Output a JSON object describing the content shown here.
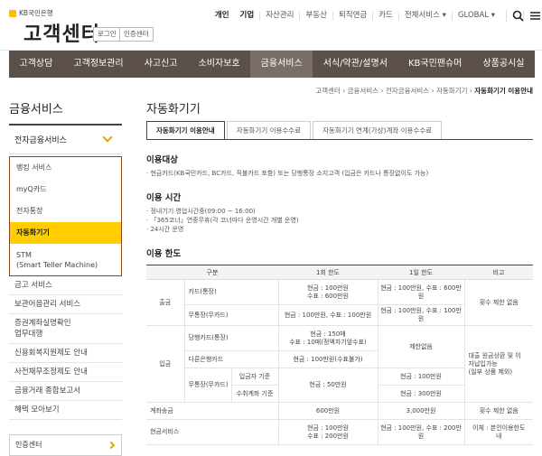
{
  "header": {
    "logo_text": "KB국민은행",
    "title": "고객센터",
    "login_label": "로그인",
    "cert_label": "인증센터",
    "util_links": [
      "개인",
      "기업",
      "자산관리",
      "부동산",
      "퇴직연금",
      "카드",
      "전체서비스 ▾",
      "GLOBAL ▾"
    ]
  },
  "gnb": [
    "고객상담",
    "고객정보관리",
    "사고신고",
    "소비자보호",
    "금융서비스",
    "서식/약관/설명서",
    "KB국민팬슈머",
    "상품공시실"
  ],
  "breadcrumb": [
    "고객센터",
    "금융서비스",
    "전자금융서비스",
    "자동화기기",
    "자동화기기 이용안내"
  ],
  "sidebar": {
    "title": "금융서비스",
    "selected": "전자금융서비스",
    "sub_items": [
      "뱅킹 서비스",
      "myQ카드",
      "전자통장",
      "자동화기기"
    ],
    "sub_last": [
      "STM",
      "(Smart Teller Machine)"
    ],
    "other_items": [
      "금고 서비스",
      "보관어음관리 서비스",
      "증권계좌실명확인",
      "업무대행",
      "신용회복지원제도 안내",
      "사전채무조정제도 안내",
      "금융거래 종합보고서",
      "혜택 모아보기"
    ],
    "cert_center": "인증센터"
  },
  "main": {
    "title": "자동화기기",
    "tabs": [
      "자동화기기 이용안내",
      "자동화기기 이용수수료",
      "자동화기기 연계(가상)계좌 이용수수료"
    ],
    "s1_title": "이용대상",
    "s1_text": "· 현금카드(KB국민카드, BC카드, 직불카드 포함) 또는 당행통장 소지고객 (입금은 카드나 통장없이도 가능)",
    "s2_title": "이용 시간",
    "s2_lines": [
      "· 정내기기 영업시간중(09:00 ~ 16:00)",
      "· 「365코너」연중무휴(각 코너마다 운영시간 개별 운영)",
      "· 24시간 운영"
    ],
    "s3_title": "이용 한도",
    "table": {
      "headers": [
        "구분",
        "1회 한도",
        "1일 한도",
        "비고"
      ],
      "c_out": "출금",
      "c_in": "입금",
      "r_card": "카드(통장)",
      "v_card1": "현금 : 100만원",
      "v_card2": "수표 : 600만원",
      "v_card_day": "현금 : 100만원, 수표 : 600만원",
      "note_out": "횟수 제한 없음",
      "r_nocard": "무통장(무카드)",
      "v_nocard": "현금 : 100만원, 수표 : 100만원",
      "v_nocard_day": "현금 : 100만원, 수표 : 100만원",
      "r_bank": "당행카드(통장)",
      "v_bank1": "현금 : 150매",
      "v_bank2": "수표 : 10매(정액자기앞수표)",
      "v_nolimit": "제한없음",
      "note_in1": "대출 원금상환 및 이",
      "note_in2": "자납입가능",
      "note_in3": "(일부 상품 제외)",
      "r_other": "다른은행카드",
      "v_other": "현금 : 100만원(수표불가)",
      "r_nocard2": "무통장(무카드)",
      "r_deposit": "입금자 기준",
      "r_receive": "수취계좌 기준",
      "v_50": "현금 : 50만원",
      "v_100": "현금 : 100만원",
      "v_300": "현금 : 300만원",
      "r_transfer": "계좌송금",
      "v_600": "600만원",
      "v_3000": "3,000만원",
      "note_transfer": "횟수 제한 없음",
      "r_cash": "현금서비스",
      "v_cash1": "현금 : 100만원",
      "v_cash2": "수표 : 200만원",
      "v_cash_day": "현금 : 100만원, 수표 : 200만원",
      "note_cash": "이체 : 본인이용한도",
      "note_cash2": "내"
    }
  },
  "colors": {
    "accent": "#ffcd00",
    "gnb_bg": "#5b514a",
    "gnb_active": "#7a6f66"
  }
}
